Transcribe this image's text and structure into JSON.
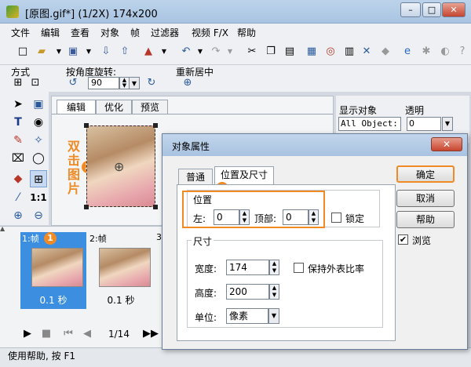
{
  "window": {
    "title": "[原图.gif*] (1/2X)  174x200",
    "minimize": "–",
    "maximize": "□",
    "close": "✕"
  },
  "menu": [
    "文件",
    "编辑",
    "查看",
    "对象",
    "帧",
    "过滤器",
    "视频 F/X",
    "帮助"
  ],
  "toolbar2": {
    "mode_label": "方式",
    "rotate_label": "按角度旋转:",
    "rotate_value": "90",
    "recenter_label": "重新居中"
  },
  "canvas_tabs": [
    "编辑",
    "优化",
    "预览"
  ],
  "annotation": {
    "double_click": "双击图片",
    "badge1": "1",
    "badge2": "2",
    "badge3": "3"
  },
  "side_panel": {
    "display_label": "显示对象",
    "display_value": "All Object:",
    "opacity_label": "透明",
    "opacity_value": "0"
  },
  "frames": [
    {
      "label": "1:帧",
      "duration": "0.1 秒"
    },
    {
      "label": "2:帧",
      "duration": "0.1 秒"
    },
    {
      "label": "3"
    }
  ],
  "playback": {
    "position": "1/14"
  },
  "status": {
    "text": "使用帮助, 按 F1"
  },
  "dialog": {
    "title": "对象属性",
    "close": "✕",
    "tabs": [
      "普通",
      "位置及尺寸"
    ],
    "position": {
      "title": "位置",
      "left_label": "左:",
      "left_value": "0",
      "top_label": "顶部:",
      "top_value": "0",
      "lock_label": "锁定"
    },
    "size": {
      "title": "尺寸",
      "width_label": "宽度:",
      "width_value": "174",
      "height_label": "高度:",
      "height_value": "200",
      "keep_ratio_label": "保持外表比率",
      "unit_label": "单位:",
      "unit_value": "像素"
    },
    "buttons": {
      "ok": "确定",
      "cancel": "取消",
      "help": "帮助"
    },
    "browse_label": "浏览",
    "browse_checked": "✔"
  },
  "colors": {
    "accent": "#f08a24",
    "titlebar": "#a9c4e2",
    "selected_frame": "#3c8fe0"
  }
}
